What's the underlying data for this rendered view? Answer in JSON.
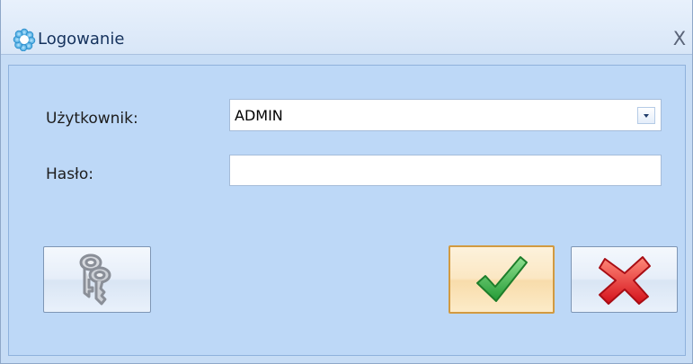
{
  "window": {
    "title": "Logowanie",
    "close_glyph": "X",
    "title_icon": "app-flower-icon"
  },
  "form": {
    "user_label": "Użytkownik:",
    "user_value": "ADMIN",
    "password_label": "Hasło:",
    "password_value": ""
  },
  "buttons": {
    "keys_icon": "keys-icon",
    "ok_icon": "checkmark-icon",
    "cancel_icon": "red-x-icon"
  },
  "colors": {
    "client_background": "#bdd8f7",
    "ok_button_highlight": "#d29a40",
    "checkmark_green": "#3fb04a",
    "cancel_red": "#e02020"
  }
}
